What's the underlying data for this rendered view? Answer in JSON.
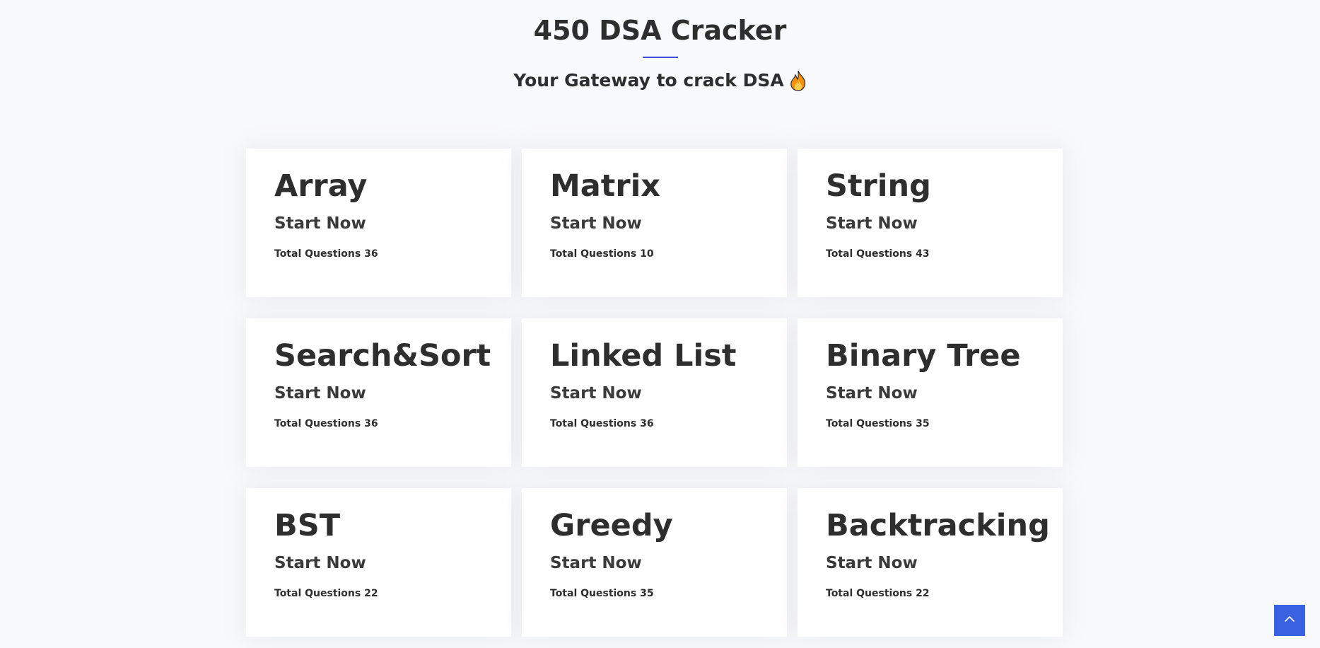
{
  "header": {
    "title": "450 DSA Cracker",
    "subtitle": "Your Gateway to crack DSA",
    "subtitle_icon": "fire-icon",
    "accent_color": "#3a50d9"
  },
  "cards": [
    {
      "title": "Array",
      "cta": "Start Now",
      "total": "Total Questions 36"
    },
    {
      "title": "Matrix",
      "cta": "Start Now",
      "total": "Total Questions 10"
    },
    {
      "title": "String",
      "cta": "Start Now",
      "total": "Total Questions 43"
    },
    {
      "title": "Search&Sort",
      "cta": "Start Now",
      "total": "Total Questions 36"
    },
    {
      "title": "Linked List",
      "cta": "Start Now",
      "total": "Total Questions 36"
    },
    {
      "title": "Binary Tree",
      "cta": "Start Now",
      "total": "Total Questions 35"
    },
    {
      "title": "BST",
      "cta": "Start Now",
      "total": "Total Questions 22"
    },
    {
      "title": "Greedy",
      "cta": "Start Now",
      "total": "Total Questions 35"
    },
    {
      "title": "Backtracking",
      "cta": "Start Now",
      "total": "Total Questions 22"
    }
  ],
  "back_to_top": {
    "icon": "chevron-up-icon",
    "color": "#3a61e0"
  }
}
